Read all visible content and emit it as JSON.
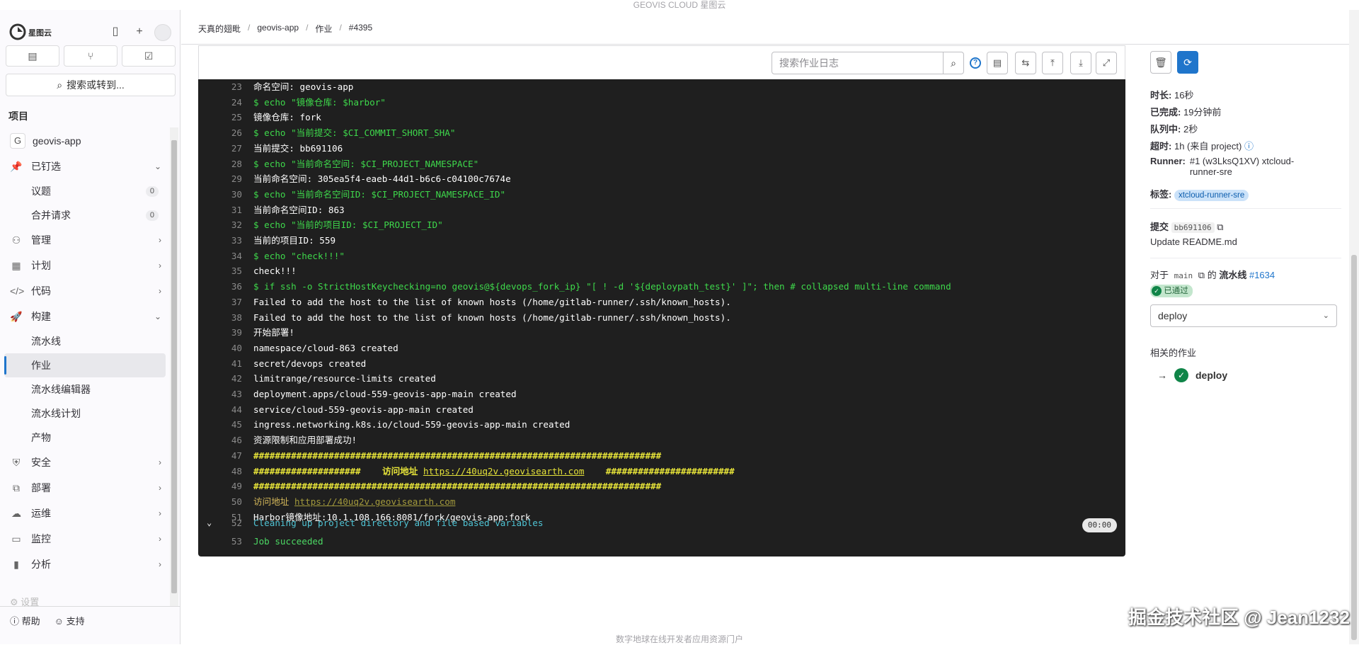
{
  "banner": "GEOVIS CLOUD 星图云",
  "footer": "数字地球在线开发者应用资源门户",
  "watermark": "掘金技术社区 @ Jean1232",
  "sidebar": {
    "brand": "星图云",
    "search_label": "搜索或转到...",
    "section_title": "项目",
    "project_name": "geovis-app",
    "project_initial": "G",
    "items": {
      "pinned": "已钉选",
      "issues": "议题",
      "issues_count": "0",
      "mrs": "合并请求",
      "mrs_count": "0",
      "manage": "管理",
      "plan": "计划",
      "code": "代码",
      "build": "构建",
      "pipelines": "流水线",
      "jobs": "作业",
      "pipeline_editor": "流水线编辑器",
      "pipeline_schedules": "流水线计划",
      "artifacts": "产物",
      "secure": "安全",
      "deploy": "部署",
      "operate": "运维",
      "monitor": "监控",
      "analyze": "分析",
      "settings": "设置"
    },
    "help": "帮助",
    "support": "支持"
  },
  "breadcrumb": {
    "group": "天真的翅毗",
    "project": "geovis-app",
    "section": "作业",
    "job": "#4395"
  },
  "log_toolbar": {
    "search_placeholder": "搜索作业日志"
  },
  "log_lines": [
    {
      "n": "23",
      "t": "命名空间: geovis-app",
      "c": ""
    },
    {
      "n": "24",
      "t": "$ echo \"镜像仓库: $harbor\"",
      "c": "c-green"
    },
    {
      "n": "25",
      "t": "镜像仓库: fork",
      "c": ""
    },
    {
      "n": "26",
      "t": "$ echo \"当前提交: $CI_COMMIT_SHORT_SHA\"",
      "c": "c-green"
    },
    {
      "n": "27",
      "t": "当前提交: bb691106",
      "c": ""
    },
    {
      "n": "28",
      "t": "$ echo \"当前命名空间: $CI_PROJECT_NAMESPACE\"",
      "c": "c-green"
    },
    {
      "n": "29",
      "t": "当前命名空间: 305ea5f4-eaeb-44d1-b6c6-c04100c7674e",
      "c": ""
    },
    {
      "n": "30",
      "t": "$ echo \"当前命名空间ID: $CI_PROJECT_NAMESPACE_ID\"",
      "c": "c-green"
    },
    {
      "n": "31",
      "t": "当前命名空间ID: 863",
      "c": ""
    },
    {
      "n": "32",
      "t": "$ echo \"当前的项目ID: $CI_PROJECT_ID\"",
      "c": "c-green"
    },
    {
      "n": "33",
      "t": "当前的项目ID: 559",
      "c": ""
    },
    {
      "n": "34",
      "t": "$ echo \"check!!!\"",
      "c": "c-green"
    },
    {
      "n": "35",
      "t": "check!!!",
      "c": ""
    },
    {
      "n": "36",
      "t": "$ if ssh -o StrictHostKeychecking=no geovis@${devops_fork_ip} \"[ ! -d '${deploypath_test}' ]\"; then # collapsed multi-line command",
      "c": "c-green"
    },
    {
      "n": "37",
      "t": "Failed to add the host to the list of known hosts (/home/gitlab-runner/.ssh/known_hosts).",
      "c": ""
    },
    {
      "n": "38",
      "t": "Failed to add the host to the list of known hosts (/home/gitlab-runner/.ssh/known_hosts).",
      "c": ""
    },
    {
      "n": "39",
      "t": "开始部署!",
      "c": ""
    },
    {
      "n": "40",
      "t": "namespace/cloud-863 created",
      "c": ""
    },
    {
      "n": "41",
      "t": "secret/devops created",
      "c": ""
    },
    {
      "n": "42",
      "t": "limitrange/resource-limits created",
      "c": ""
    },
    {
      "n": "43",
      "t": "deployment.apps/cloud-559-geovis-app-main created",
      "c": ""
    },
    {
      "n": "44",
      "t": "service/cloud-559-geovis-app-main created",
      "c": ""
    },
    {
      "n": "45",
      "t": "ingress.networking.k8s.io/cloud-559-geovis-app-main created",
      "c": ""
    },
    {
      "n": "46",
      "t": "资源限制和应用部署成功!",
      "c": ""
    },
    {
      "n": "47",
      "t": "############################################################################",
      "c": "c-yellow"
    },
    {
      "n": "48",
      "t": "####################    访问地址 ",
      "c": "c-yellow",
      "link": "https://40uq2v.geovisearth.com",
      "tail": "    ########################"
    },
    {
      "n": "49",
      "t": "############################################################################",
      "c": "c-yellow"
    },
    {
      "n": "50",
      "t": "访问地址 ",
      "c": "c-dim",
      "link2": "https://40uq2v.geovisearth.com"
    },
    {
      "n": "51",
      "t": "Harbor镜像地址:10.1.108.166:8081/fork/geovis-app:fork",
      "c": ""
    },
    {
      "n": "52",
      "t": "Cleaning up project directory and file based variables",
      "c": "c-cyan"
    },
    {
      "n": "53",
      "t": "Job succeeded",
      "c": "c-green2"
    }
  ],
  "duration_badge": "00:00",
  "job_info": {
    "duration_label": "时长:",
    "duration": "16秒",
    "finished_label": "已完成:",
    "finished": "19分钟前",
    "queued_label": "队列中:",
    "queued": "2秒",
    "timeout_label": "超时:",
    "timeout": "1h (来自 project)",
    "runner_label": "Runner:",
    "runner_line1": "#1 (w3LksQ1XV) xtcloud-",
    "runner_line2": "runner-sre",
    "tags_label": "标签:",
    "tag": "xtcloud-runner-sre"
  },
  "commit": {
    "label": "提交",
    "sha": "bb691106",
    "message": "Update README.md"
  },
  "pipeline": {
    "for_label": "对于",
    "branch": "main",
    "of_label": "的",
    "pipeline_label": "流水线",
    "pipeline_id": "#1634",
    "status": "已通过",
    "stage_select": "deploy"
  },
  "related": {
    "title": "相关的作业",
    "job_name": "deploy"
  },
  "colors": {
    "accent": "#1f75cb",
    "success": "#108548",
    "log_bg": "#1f1f1f"
  }
}
